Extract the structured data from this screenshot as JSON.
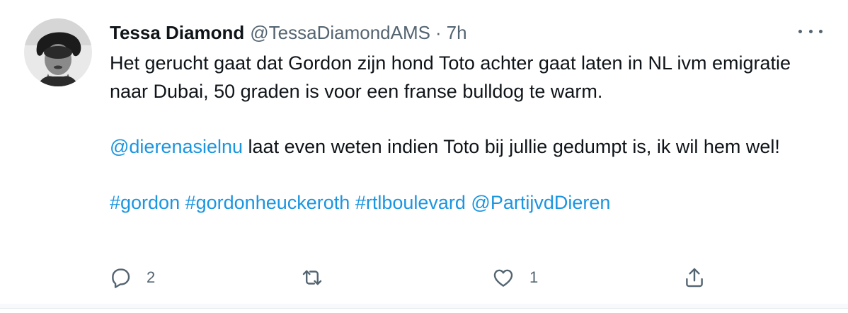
{
  "tweet": {
    "author_name": "Tessa Diamond",
    "author_handle": "@TessaDiamondAMS",
    "separator": "·",
    "time_ago": "7h",
    "text_line1": "Het gerucht gaat dat Gordon zijn hond Toto achter gaat laten in NL ivm emigratie naar Dubai, 50 graden is voor een franse bulldog te warm.",
    "mention_1": "@dierenasielnu",
    "text_line2": " laat even weten indien Toto bij jullie gedumpt is, ik wil hem wel!",
    "hashtag_1": "#gordon",
    "hashtag_2": "#gordonheuckeroth",
    "hashtag_3": "#rtlboulevard",
    "mention_2": "@PartijvdDieren"
  },
  "actions": {
    "reply_icon": "reply-icon",
    "reply_count": "2",
    "retweet_icon": "retweet-icon",
    "retweet_count": "",
    "like_icon": "heart-icon",
    "like_count": "1",
    "share_icon": "share-icon"
  },
  "colors": {
    "link": "#1b95e0",
    "secondary_text": "#536471",
    "primary_text": "#0f1419"
  }
}
